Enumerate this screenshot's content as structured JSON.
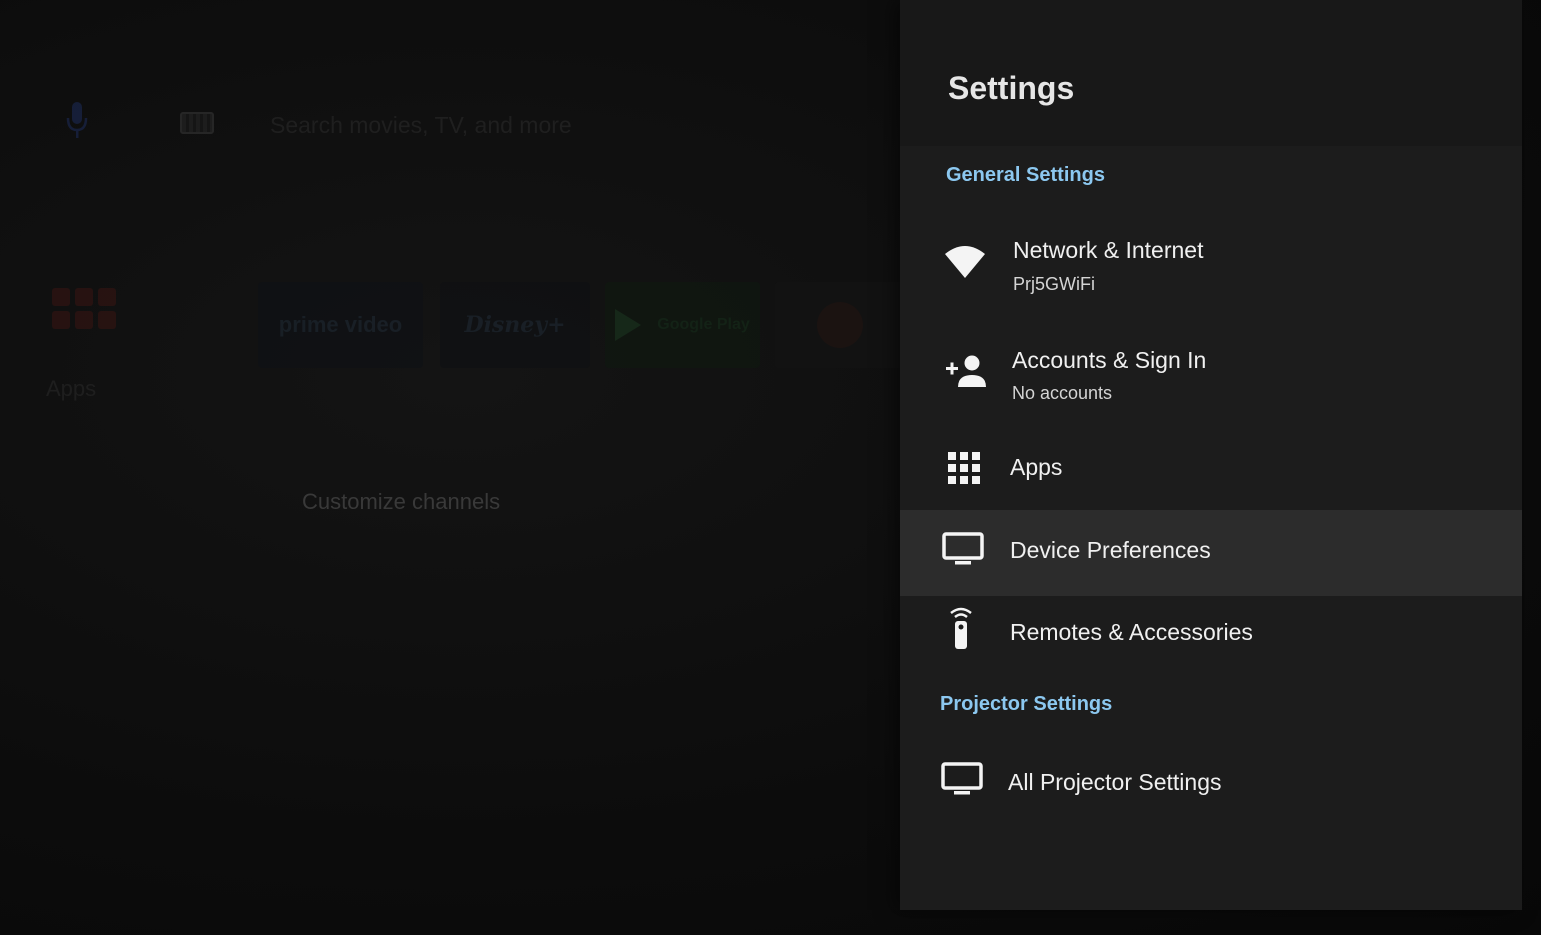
{
  "home": {
    "search_placeholder": "Search movies, TV, and more",
    "apps_label": "Apps",
    "channels": [
      "prime video",
      "Disney+",
      "Google Play",
      ""
    ],
    "customize_label": "Customize channels"
  },
  "settings": {
    "title": "Settings",
    "sections": {
      "general": "General Settings",
      "projector": "Projector Settings"
    },
    "items": {
      "network": {
        "title": "Network & Internet",
        "subtitle": "Prj5GWiFi",
        "icon": "wifi-icon"
      },
      "accounts": {
        "title": "Accounts & Sign In",
        "subtitle": "No accounts",
        "icon": "person-add-icon"
      },
      "apps": {
        "title": "Apps",
        "icon": "apps-grid-icon"
      },
      "device": {
        "title": "Device Preferences",
        "icon": "monitor-icon",
        "focused": true
      },
      "remotes": {
        "title": "Remotes & Accessories",
        "icon": "remote-icon"
      },
      "projector_all": {
        "title": "All Projector Settings",
        "icon": "monitor-icon"
      }
    }
  },
  "colors": {
    "section_label": "#8cc8f0",
    "panel_bg": "#1c1c1c",
    "focus_bg": "#2c2c2c",
    "text_primary": "#f0f0f0"
  }
}
